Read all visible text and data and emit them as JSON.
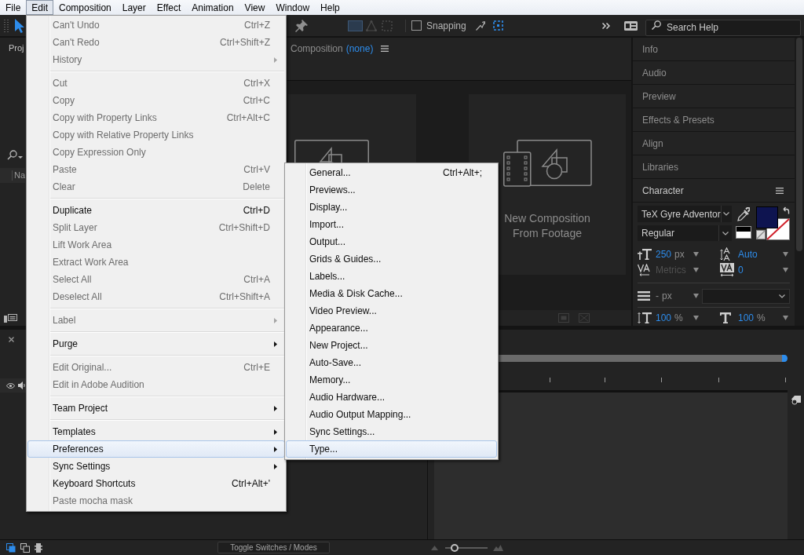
{
  "menu_bar": {
    "items": [
      {
        "label": "File",
        "selected": false
      },
      {
        "label": "Edit",
        "selected": true
      },
      {
        "label": "Composition",
        "selected": false
      },
      {
        "label": "Layer",
        "selected": false
      },
      {
        "label": "Effect",
        "selected": false
      },
      {
        "label": "Animation",
        "selected": false
      },
      {
        "label": "View",
        "selected": false
      },
      {
        "label": "Window",
        "selected": false
      },
      {
        "label": "Help",
        "selected": false
      }
    ]
  },
  "toolbar": {
    "snapping": {
      "label": "Snapping",
      "checked": false
    },
    "search": {
      "placeholder": "Search Help"
    }
  },
  "project_panel": {
    "title": "Proj",
    "column_1": "Na"
  },
  "composition_panel": {
    "title": "Composition",
    "comp_name": "(none)",
    "cards": [
      {
        "kind": "new-composition"
      },
      {
        "kind": "from-footage",
        "label": "New Composition From Footage"
      }
    ]
  },
  "panels": [
    {
      "title": "Info",
      "expanded": false
    },
    {
      "title": "Audio",
      "expanded": false
    },
    {
      "title": "Preview",
      "expanded": false
    },
    {
      "title": "Effects & Presets",
      "expanded": false
    },
    {
      "title": "Align",
      "expanded": false
    },
    {
      "title": "Libraries",
      "expanded": false
    },
    {
      "title": "Character",
      "expanded": true
    }
  ],
  "character": {
    "font_family": "TeX Gyre Adventor",
    "font_style": "Regular",
    "size": {
      "value": "250",
      "unit": "px"
    },
    "leading": {
      "value": "Auto"
    },
    "kerning": {
      "value": "Metrics",
      "disabled": true
    },
    "tracking": {
      "value": "0"
    },
    "stroke_width": {
      "value": "-",
      "unit": "px"
    },
    "vertical_scale": {
      "value": "100",
      "unit": "%"
    },
    "horizontal_scale": {
      "value": "100",
      "unit": "%"
    }
  },
  "timeline": {
    "toggle_button": "Toggle Switches / Modes",
    "zoom_slider": {
      "level": 0.15
    }
  },
  "edit_menu": {
    "groups": [
      {
        "items": [
          {
            "label": "Can't Undo",
            "shortcut": "Ctrl+Z",
            "disabled": true,
            "submenu": false,
            "selected": false
          },
          {
            "label": "Can't Redo",
            "shortcut": "Ctrl+Shift+Z",
            "disabled": true,
            "submenu": false,
            "selected": false
          },
          {
            "label": "History",
            "disabled": true,
            "submenu": true,
            "selected": false
          }
        ]
      },
      {
        "items": [
          {
            "label": "Cut",
            "shortcut": "Ctrl+X",
            "disabled": true,
            "submenu": false,
            "selected": false
          },
          {
            "label": "Copy",
            "shortcut": "Ctrl+C",
            "disabled": true,
            "submenu": false,
            "selected": false
          },
          {
            "label": "Copy with Property Links",
            "shortcut": "Ctrl+Alt+C",
            "disabled": true,
            "submenu": false,
            "selected": false
          },
          {
            "label": "Copy with Relative Property Links",
            "disabled": true,
            "submenu": false,
            "selected": false
          },
          {
            "label": "Copy Expression Only",
            "disabled": true,
            "submenu": false,
            "selected": false
          },
          {
            "label": "Paste",
            "shortcut": "Ctrl+V",
            "disabled": true,
            "submenu": false,
            "selected": false
          },
          {
            "label": "Clear",
            "shortcut": "Delete",
            "disabled": true,
            "submenu": false,
            "selected": false
          }
        ]
      },
      {
        "items": [
          {
            "label": "Duplicate",
            "shortcut": "Ctrl+D",
            "disabled": false,
            "submenu": false,
            "selected": false
          },
          {
            "label": "Split Layer",
            "shortcut": "Ctrl+Shift+D",
            "disabled": true,
            "submenu": false,
            "selected": false
          },
          {
            "label": "Lift Work Area",
            "disabled": true,
            "submenu": false,
            "selected": false
          },
          {
            "label": "Extract Work Area",
            "disabled": true,
            "submenu": false,
            "selected": false
          },
          {
            "label": "Select All",
            "shortcut": "Ctrl+A",
            "disabled": true,
            "submenu": false,
            "selected": false
          },
          {
            "label": "Deselect All",
            "shortcut": "Ctrl+Shift+A",
            "disabled": true,
            "submenu": false,
            "selected": false
          }
        ]
      },
      {
        "items": [
          {
            "label": "Label",
            "disabled": true,
            "submenu": true,
            "selected": false
          }
        ]
      },
      {
        "items": [
          {
            "label": "Purge",
            "disabled": false,
            "submenu": true,
            "selected": false
          }
        ]
      },
      {
        "items": [
          {
            "label": "Edit Original...",
            "shortcut": "Ctrl+E",
            "disabled": true,
            "submenu": false,
            "selected": false
          },
          {
            "label": "Edit in Adobe Audition",
            "disabled": true,
            "submenu": false,
            "selected": false
          }
        ]
      },
      {
        "items": [
          {
            "label": "Team Project",
            "disabled": false,
            "submenu": true,
            "selected": false
          }
        ]
      },
      {
        "items": [
          {
            "label": "Templates",
            "disabled": false,
            "submenu": true,
            "selected": false
          },
          {
            "label": "Preferences",
            "disabled": false,
            "submenu": true,
            "selected": true
          },
          {
            "label": "Sync Settings",
            "disabled": false,
            "submenu": true,
            "selected": false
          },
          {
            "label": "Keyboard Shortcuts",
            "shortcut": "Ctrl+Alt+'",
            "disabled": false,
            "submenu": false,
            "selected": false
          },
          {
            "label": "Paste mocha mask",
            "disabled": true,
            "submenu": false,
            "selected": false
          }
        ]
      }
    ]
  },
  "preferences_menu": {
    "items": [
      {
        "label": "General...",
        "shortcut": "Ctrl+Alt+;",
        "selected": false
      },
      {
        "label": "Previews...",
        "selected": false
      },
      {
        "label": "Display...",
        "selected": false
      },
      {
        "label": "Import...",
        "selected": false
      },
      {
        "label": "Output...",
        "selected": false
      },
      {
        "label": "Grids & Guides...",
        "selected": false
      },
      {
        "label": "Labels...",
        "selected": false
      },
      {
        "label": "Media & Disk Cache...",
        "selected": false
      },
      {
        "label": "Video Preview...",
        "selected": false
      },
      {
        "label": "Appearance...",
        "selected": false
      },
      {
        "label": "New Project...",
        "selected": false
      },
      {
        "label": "Auto-Save...",
        "selected": false
      },
      {
        "label": "Memory...",
        "selected": false
      },
      {
        "label": "Audio Hardware...",
        "selected": false
      },
      {
        "label": "Audio Output Mapping...",
        "selected": false
      },
      {
        "label": "Sync Settings...",
        "selected": false
      },
      {
        "label": "Type...",
        "selected": true
      }
    ]
  }
}
